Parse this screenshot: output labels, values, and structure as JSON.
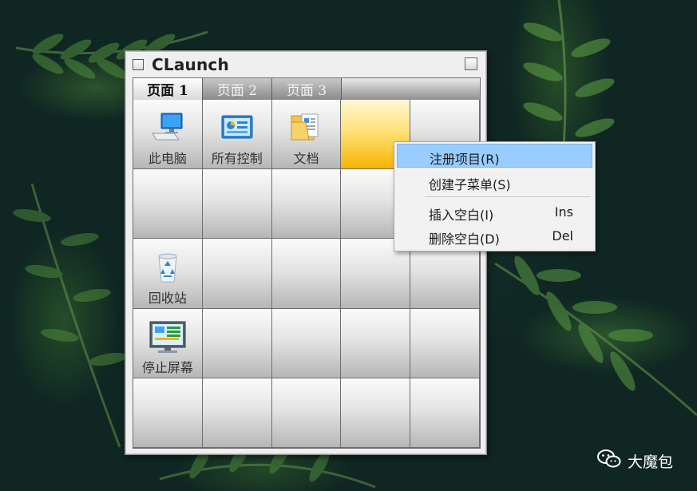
{
  "window": {
    "title": "CLaunch",
    "tabs": [
      {
        "label": "页面 1",
        "active": true
      },
      {
        "label": "页面 2",
        "active": false
      },
      {
        "label": "页面 3",
        "active": false
      }
    ],
    "grid": {
      "items": [
        {
          "label": "此电脑",
          "icon": "computer-icon"
        },
        {
          "label": "所有控制",
          "icon": "control-panel-icon"
        },
        {
          "label": "文档",
          "icon": "documents-folder-icon"
        },
        {
          "label": "回收站",
          "icon": "recycle-bin-icon"
        },
        {
          "label": "停止屏幕",
          "icon": "screen-monitor-icon"
        }
      ]
    }
  },
  "context_menu": {
    "items": [
      {
        "label": "注册项目(R)",
        "shortcut": ""
      },
      {
        "label": "创建子菜单(S)",
        "shortcut": ""
      },
      {
        "label": "插入空白(I)",
        "shortcut": "Ins"
      },
      {
        "label": "删除空白(D)",
        "shortcut": "Del"
      }
    ]
  },
  "watermark": {
    "text": "大魔包",
    "icon": "wechat-icon"
  },
  "colors": {
    "selected_cell": "#ffe27a",
    "menu_highlight": "#99ccff",
    "background": "#0f2623"
  }
}
